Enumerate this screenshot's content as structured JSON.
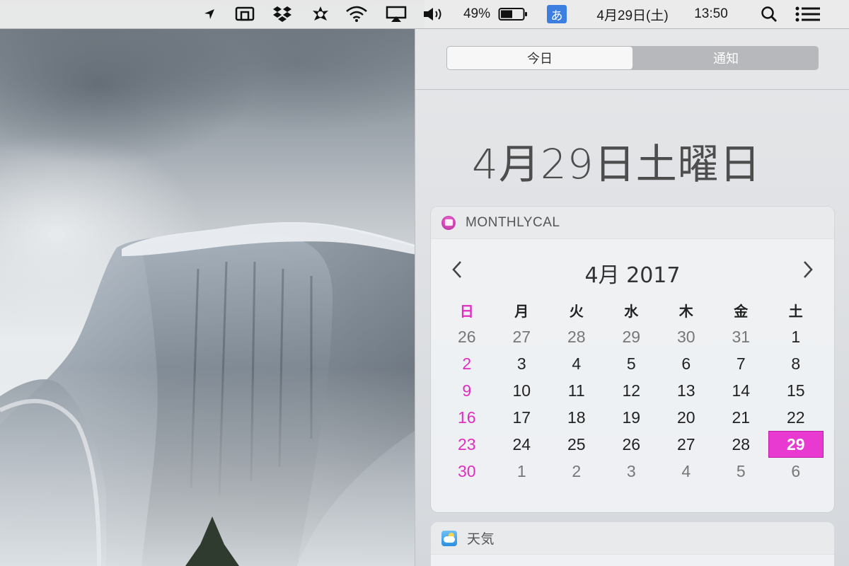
{
  "menubar": {
    "battery_percent": "49%",
    "ime_char": "あ",
    "date": "4月29日(土)",
    "time": "13:50",
    "icons": [
      "location-arrow-icon",
      "airplay-cast-icon",
      "dropbox-icon",
      "app-sync-icon",
      "wifi-icon",
      "airplay-display-icon",
      "volume-icon",
      "battery-icon",
      "input-method-icon",
      "spotlight-search-icon",
      "notification-center-icon"
    ]
  },
  "notification_center": {
    "tabs": [
      {
        "label": "今日",
        "active": true
      },
      {
        "label": "通知",
        "active": false
      }
    ],
    "date_heading": "4月29日土曜日",
    "monthlycal": {
      "title": "MONTHLYCAL",
      "month_title": "4月 2017",
      "accent_color": "#e83ad0",
      "weekdays": [
        "日",
        "月",
        "火",
        "水",
        "木",
        "金",
        "土"
      ],
      "weeks": [
        [
          {
            "d": "26",
            "dim": true
          },
          {
            "d": "27",
            "dim": true
          },
          {
            "d": "28",
            "dim": true
          },
          {
            "d": "29",
            "dim": true
          },
          {
            "d": "30",
            "dim": true
          },
          {
            "d": "31",
            "dim": true
          },
          {
            "d": "1"
          }
        ],
        [
          {
            "d": "2"
          },
          {
            "d": "3"
          },
          {
            "d": "4"
          },
          {
            "d": "5"
          },
          {
            "d": "6"
          },
          {
            "d": "7"
          },
          {
            "d": "8"
          }
        ],
        [
          {
            "d": "9"
          },
          {
            "d": "10"
          },
          {
            "d": "11"
          },
          {
            "d": "12"
          },
          {
            "d": "13"
          },
          {
            "d": "14"
          },
          {
            "d": "15"
          }
        ],
        [
          {
            "d": "16"
          },
          {
            "d": "17"
          },
          {
            "d": "18"
          },
          {
            "d": "19"
          },
          {
            "d": "20"
          },
          {
            "d": "21"
          },
          {
            "d": "22"
          }
        ],
        [
          {
            "d": "23"
          },
          {
            "d": "24"
          },
          {
            "d": "25"
          },
          {
            "d": "26"
          },
          {
            "d": "27"
          },
          {
            "d": "28"
          },
          {
            "d": "29",
            "today": true
          }
        ],
        [
          {
            "d": "30"
          },
          {
            "d": "1",
            "dim": true
          },
          {
            "d": "2",
            "dim": true
          },
          {
            "d": "3",
            "dim": true
          },
          {
            "d": "4",
            "dim": true
          },
          {
            "d": "5",
            "dim": true
          },
          {
            "d": "6",
            "dim": true
          }
        ]
      ]
    },
    "weather": {
      "title": "天気"
    }
  }
}
